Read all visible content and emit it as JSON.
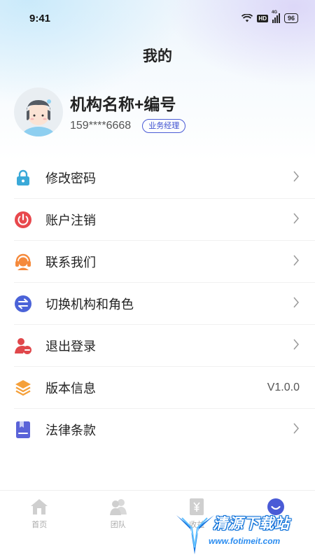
{
  "status_bar": {
    "time": "9:41",
    "network_label": "4G",
    "hd_label": "HD",
    "battery_level": "96"
  },
  "page": {
    "title": "我的"
  },
  "profile": {
    "org_name": "机构名称+编号",
    "phone": "159****6668",
    "role_badge": "业务经理"
  },
  "menu": {
    "items": [
      {
        "label": "修改密码",
        "icon": "lock-icon",
        "color": "#3aa9d8",
        "trailing": "chevron"
      },
      {
        "label": "账户注销",
        "icon": "power-off-icon",
        "color": "#e8484d",
        "trailing": "chevron"
      },
      {
        "label": "联系我们",
        "icon": "headset-icon",
        "color": "#f58a3c",
        "trailing": "chevron"
      },
      {
        "label": "切换机构和角色",
        "icon": "switch-arrows-icon",
        "color": "#4b63d8",
        "trailing": "chevron"
      },
      {
        "label": "退出登录",
        "icon": "user-logout-icon",
        "color": "#e0474b",
        "trailing": "chevron"
      },
      {
        "label": "版本信息",
        "icon": "layers-icon",
        "color": "#f5a03a",
        "trailing": "V1.0.0"
      },
      {
        "label": "法律条款",
        "icon": "bookmark-doc-icon",
        "color": "#5a63d8",
        "trailing": "chevron"
      }
    ]
  },
  "tab_bar": {
    "tabs": [
      {
        "label": "首页",
        "icon": "home-icon",
        "active": false
      },
      {
        "label": "团队",
        "icon": "team-icon",
        "active": false
      },
      {
        "label": "收益",
        "icon": "yuan-icon",
        "active": false
      },
      {
        "label": "我的",
        "icon": "smile-icon",
        "active": true
      }
    ],
    "active_color": "#4a5bd6",
    "inactive_color": "#cfcfcf"
  },
  "watermark": {
    "title": "清源下载站",
    "url": "www.fotimeit.com"
  }
}
